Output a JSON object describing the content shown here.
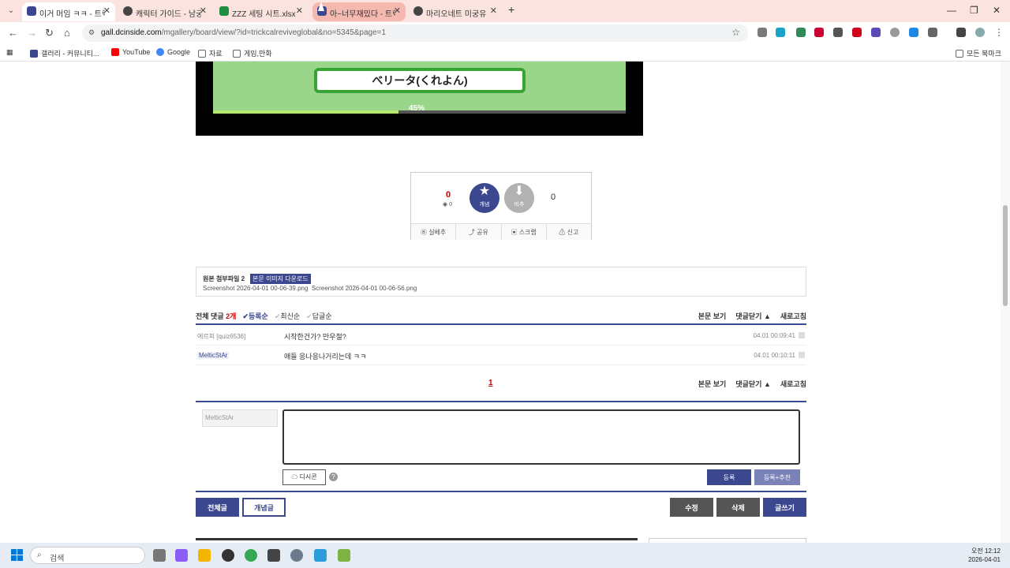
{
  "tabs": [
    {
      "title": "이거 머임 ㅋㅋ - 트릭컬",
      "color": "#3b4890",
      "state": "active"
    },
    {
      "title": "캐릭터 가이드 - 남궁",
      "color": "#444444",
      "state": "normal"
    },
    {
      "title": "ZZZ 세팅 시트.xlsx",
      "color": "#1e8e3e",
      "state": "normal"
    },
    {
      "title": "아~너무재밌다 - 트릭컬",
      "color": "#3b4890",
      "state": "highlight"
    },
    {
      "title": "마리오네트 미궁유",
      "color": "#444444",
      "state": "normal"
    }
  ],
  "address": {
    "host": "gall.dcinside.com",
    "path": "/mgallery/board/view/?id=trickcalreviveglobal&no=5345&page=1"
  },
  "bookmarks": [
    {
      "label": "갤러리 - 커뮤니티...",
      "icon": "gallery-icon",
      "color": "#3b4890"
    },
    {
      "label": "YouTube",
      "icon": "youtube-icon",
      "color": "#ff0000"
    },
    {
      "label": "Google",
      "icon": "google-icon",
      "color": "#4285f4"
    },
    {
      "label": "자료",
      "icon": "folder-icon",
      "color": "#666666"
    },
    {
      "label": "게임,만화",
      "icon": "folder-icon",
      "color": "#666666"
    }
  ],
  "bookmarks_right": "모든 북마크",
  "game": {
    "name_box": "べリータ(くれよん)",
    "progress_label": "45%",
    "progress": 0.45
  },
  "vote": {
    "up_count": "0",
    "fix_count": "0",
    "up_label": "개념",
    "down_label": "비추",
    "down_count": "0",
    "actions": [
      "실베추",
      "공유",
      "스크랩",
      "신고"
    ]
  },
  "attach": {
    "label": "원본 첨부파일 2",
    "download": "본문 이미지 다운로드",
    "files": [
      "Screenshot 2026-04-01 00-06-39.png",
      "Screenshot 2026-04-01 00-06-56.png"
    ]
  },
  "comments_header": {
    "total_label": "전체 댓글",
    "total_count": "2개",
    "sorts": [
      "등록순",
      "최신순",
      "답글순"
    ],
    "right": [
      "본문 보기",
      "댓글닫기 ▲",
      "새로고침"
    ]
  },
  "comments": [
    {
      "nick": "에르피 [quiz6536]",
      "body": "시작한건가? 만우절?",
      "time": "04.01 00:09:41"
    },
    {
      "nick": "MelticStAr",
      "body": "애들 응나응나거리는데 ㅋㅋ",
      "time": "04.01 00:10:11"
    }
  ],
  "pager": {
    "current": "1"
  },
  "write": {
    "nickname_placeholder": "MelticStAr",
    "dccon": "디시콘",
    "help": "?",
    "submit": "등록",
    "submit_recommend": "등록+추천"
  },
  "board_buttons": {
    "all": "전체글",
    "concept": "개념글",
    "edit": "수정",
    "delete": "삭제",
    "write": "글쓰기"
  },
  "taskbar": {
    "search_placeholder": "검색",
    "time": "오전 12:12",
    "date": "2026-04-01"
  }
}
